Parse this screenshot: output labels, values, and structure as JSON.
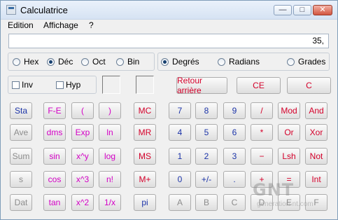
{
  "window": {
    "title": "Calculatrice",
    "controls": {
      "minimize": "—",
      "maximize": "□",
      "close": "✕"
    }
  },
  "menu": [
    "Edition",
    "Affichage",
    "?"
  ],
  "display": {
    "value": "35,"
  },
  "base": {
    "options": [
      "Hex",
      "Déc",
      "Oct",
      "Bin"
    ],
    "selected": "Déc"
  },
  "angle": {
    "options": [
      "Degrés",
      "Radians",
      "Grades"
    ],
    "selected": "Degrés"
  },
  "checks": {
    "inv": "Inv",
    "hyp": "Hyp"
  },
  "edit_buttons": {
    "backspace": "Retour arrière",
    "ce": "CE",
    "c": "C"
  },
  "stats": [
    "Sta",
    "Ave",
    "Sum",
    "s",
    "Dat"
  ],
  "sci": [
    [
      "F-E",
      "(",
      ")"
    ],
    [
      "dms",
      "Exp",
      "ln"
    ],
    [
      "sin",
      "x^y",
      "log"
    ],
    [
      "cos",
      "x^3",
      "n!"
    ],
    [
      "tan",
      "x^2",
      "1/x"
    ]
  ],
  "memory": [
    "MC",
    "MR",
    "MS",
    "M+",
    "pi"
  ],
  "numpad": [
    [
      "7",
      "8",
      "9",
      "/",
      "Mod",
      "And"
    ],
    [
      "4",
      "5",
      "6",
      "*",
      "Or",
      "Xor"
    ],
    [
      "1",
      "2",
      "3",
      "−",
      "Lsh",
      "Not"
    ],
    [
      "0",
      "+/-",
      ".",
      "+",
      "=",
      "Int"
    ],
    [
      "A",
      "B",
      "C",
      "D",
      "E",
      "F"
    ]
  ],
  "watermark": {
    "logo": "GNT",
    "url": "generation-nt.com"
  }
}
